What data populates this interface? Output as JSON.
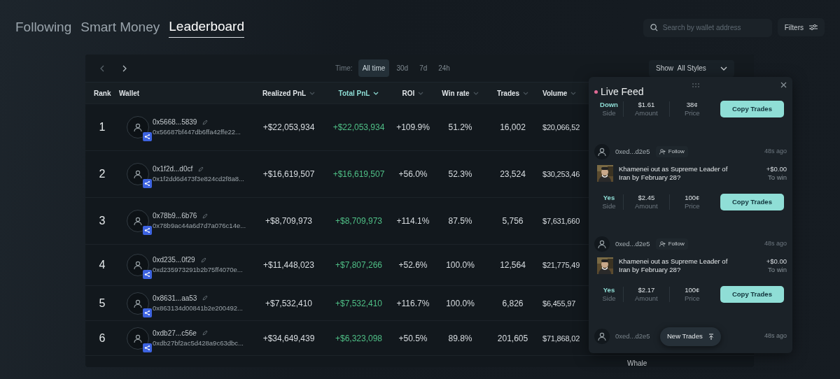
{
  "tabs": [
    {
      "label": "Following",
      "selected": false
    },
    {
      "label": "Smart Money",
      "selected": false
    },
    {
      "label": "Leaderboard",
      "selected": true
    }
  ],
  "search": {
    "placeholder": "Search by wallet address"
  },
  "filters_button": "Filters",
  "toolbar": {
    "time_label": "Time:",
    "time_options": [
      {
        "label": "All time",
        "selected": true
      },
      {
        "label": "30d",
        "selected": false
      },
      {
        "label": "7d",
        "selected": false
      },
      {
        "label": "24h",
        "selected": false
      }
    ],
    "show_label": "Show",
    "show_value": "All Styles"
  },
  "table": {
    "columns": [
      {
        "label": "Rank",
        "kind": "plain",
        "selected": false
      },
      {
        "label": "Wallet",
        "kind": "plain",
        "selected": false
      },
      {
        "label": "Realized PnL",
        "kind": "sortable",
        "selected": false
      },
      {
        "label": "Total PnL",
        "kind": "sortable",
        "selected": true
      },
      {
        "label": "ROI",
        "kind": "sortable",
        "selected": false
      },
      {
        "label": "Win rate",
        "kind": "sortable",
        "selected": false
      },
      {
        "label": "Trades",
        "kind": "sortable",
        "selected": false
      },
      {
        "label": "Volume",
        "kind": "sortable",
        "selected": false
      }
    ],
    "rows": [
      {
        "rank": "1",
        "short": "0x5668...5839",
        "address": "0x56687bf447db6ffa42ffe22...",
        "realized": "+$22,053,934",
        "total": "+$22,053,934",
        "roi": "+109.9%",
        "win_rate": "51.2%",
        "trades": "16,002",
        "volume": "$20,066,52"
      },
      {
        "rank": "2",
        "short": "0x1f2d...d0cf",
        "address": "0x1f2dd6d473f3e824cd2f8a8...",
        "realized": "+$16,619,507",
        "total": "+$16,619,507",
        "roi": "+56.0%",
        "win_rate": "52.3%",
        "trades": "23,524",
        "volume": "$30,253,46"
      },
      {
        "rank": "3",
        "short": "0x78b9...6b76",
        "address": "0x78b9ac44a6d7d7a076c14e...",
        "realized": "+$8,709,973",
        "total": "+$8,709,973",
        "roi": "+114.1%",
        "win_rate": "87.5%",
        "trades": "5,756",
        "volume": "$7,631,660"
      },
      {
        "rank": "4",
        "short": "0xd235...0f29",
        "address": "0xd235973291b2b75ff4070e...",
        "realized": "+$11,448,023",
        "total": "+$7,807,266",
        "roi": "+52.6%",
        "win_rate": "100.0%",
        "trades": "12,564",
        "volume": "$21,775,49"
      },
      {
        "rank": "5",
        "short": "0x8631...aa53",
        "address": "0x863134d00841b2e200492...",
        "realized": "+$7,532,410",
        "total": "+$7,532,410",
        "roi": "+116.7%",
        "win_rate": "100.0%",
        "trades": "6,826",
        "volume": "$6,455,97"
      },
      {
        "rank": "6",
        "short": "0xdb27...c56e",
        "address": "0xdb27bf2ac5d428a9c63dbc...",
        "realized": "+$34,649,439",
        "total": "+$6,323,098",
        "roi": "+50.5%",
        "win_rate": "89.8%",
        "trades": "201,605",
        "volume": "$71,868,02"
      }
    ],
    "partial_row": {
      "style": "Whale"
    }
  },
  "live_feed": {
    "title": "Live Feed",
    "items": [
      {
        "kind": "stats_only",
        "side": "Down",
        "side_label": "Side",
        "amount": "$1.61",
        "amount_label": "Amount",
        "price": "38¢",
        "price_label": "Price",
        "button": "Copy Trades"
      },
      {
        "kind": "full",
        "user": "0xed...d2e5",
        "follow": "Follow",
        "time": "48s ago",
        "question": "Khamenei out as Supreme Leader of Iran by February 28?",
        "to_win": "+$0.00",
        "to_win_label": "To win",
        "side": "Yes",
        "side_label": "Side",
        "amount": "$2.45",
        "amount_label": "Amount",
        "price": "100¢",
        "price_label": "Price",
        "button": "Copy Trades"
      },
      {
        "kind": "full",
        "user": "0xed...d2e5",
        "follow": "Follow",
        "time": "48s ago",
        "question": "Khamenei out as Supreme Leader of Iran by February 28?",
        "to_win": "+$0.00",
        "to_win_label": "To win",
        "side": "Yes",
        "side_label": "Side",
        "amount": "$2.17",
        "amount_label": "Amount",
        "price": "100¢",
        "price_label": "Price",
        "button": "Copy Trades"
      },
      {
        "kind": "header_only",
        "user": "0xed...d2e5",
        "time": "48s ago"
      }
    ],
    "new_trades": "New Trades"
  }
}
